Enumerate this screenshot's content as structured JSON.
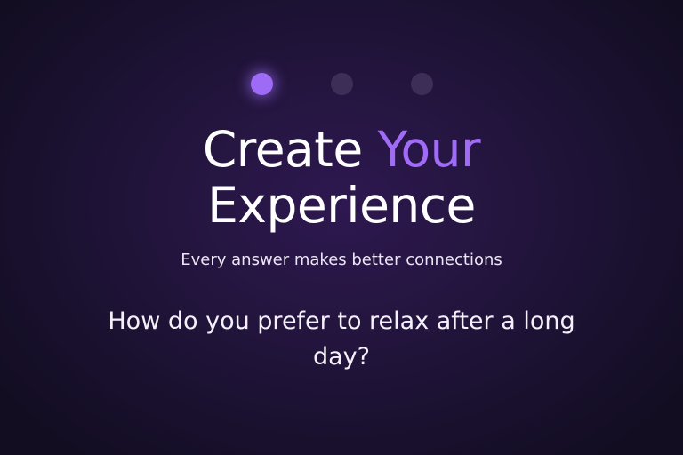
{
  "stepper": {
    "steps": [
      {
        "label": "step-1",
        "active": true
      },
      {
        "label": "step-2",
        "active": false
      },
      {
        "label": "step-3",
        "active": false
      }
    ],
    "active_color": "#9d6bf5",
    "inactive_color": "#3d2e57"
  },
  "header": {
    "title_part1": "Create",
    "title_accent": "Your",
    "title_part2": "Experience",
    "subtitle": "Every answer makes better connections"
  },
  "question": {
    "text": "How do you prefer to relax after a long day?"
  },
  "colors": {
    "accent": "#a06bf6",
    "background": "#24153f"
  }
}
